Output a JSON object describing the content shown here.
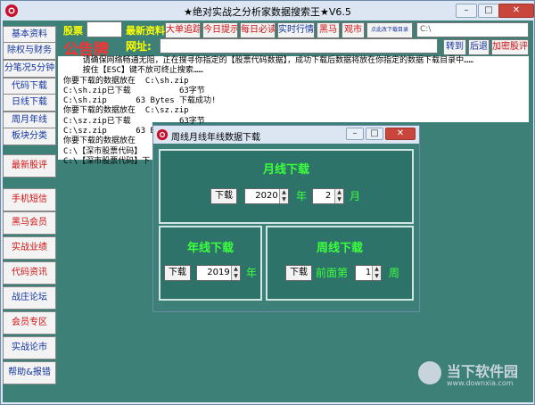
{
  "window": {
    "title": "★绝对实战之分析家数据搜索王★V6.5",
    "min": "–",
    "max": "□",
    "close": "✕"
  },
  "sidebar": [
    {
      "label": "基本资料",
      "color": "#1233a0"
    },
    {
      "label": "除权与财务",
      "color": "#1233a0"
    },
    {
      "label": "分笔况5分钟",
      "color": "#1233a0"
    },
    {
      "label": "代码下载",
      "color": "#1233a0"
    },
    {
      "label": "日线下载",
      "color": "#1233a0"
    },
    {
      "label": "周月年线",
      "color": "#1233a0"
    },
    {
      "label": "板块分类",
      "color": "#1233a0"
    },
    {
      "label": "最新股评",
      "color": "#d01010"
    },
    {
      "label": "手机短信",
      "color": "#d01010"
    },
    {
      "label": "黑马会员",
      "color": "#d01010"
    },
    {
      "label": "实战业绩",
      "color": "#d01010"
    },
    {
      "label": "代码资讯",
      "color": "#d01010"
    },
    {
      "label": "战庄论坛",
      "color": "#1233a0"
    },
    {
      "label": "会员专区",
      "color": "#d01010"
    },
    {
      "label": "实战论市",
      "color": "#1233a0"
    },
    {
      "label": "帮助&报错",
      "color": "#1233a0"
    }
  ],
  "toolbar": {
    "stock_label": "股票",
    "latest_label": "最新资料",
    "buttons": [
      "大单追踪",
      "今日提示",
      "每日必读",
      "实时行情",
      "黑马",
      "观市"
    ],
    "download_btn": "点此改下载目录",
    "path_value": "C:\\",
    "notice_label": "公告牌",
    "url_label": "网址:",
    "goto_btn": "转到",
    "back_btn": "后退",
    "fav_btn": "加密股评"
  },
  "log_lines": [
    "    请确保网络畅通无阻，正在搜寻你指定的【股票代码数据】，成功下载后数据将放在你指定的数据下载目录中……",
    "    按住【ESC】键不放可终止搜索……",
    "你要下载的数据放在  C:\\sh.zip",
    "C:\\sh.zip已下载          63字节",
    "C:\\sh.zip      63 Bytes 下载成功!",
    "你要下载的数据放在  C:\\sz.zip",
    "C:\\sz.zip已下载          63字节",
    "C:\\sz.zip      63 Bytes 下载成功!",
    "你要下载的数据放在",
    "C:\\【深市股票代码】",
    "C:\\【深市股票代码】下"
  ],
  "dialog": {
    "title": "周线月线年线数据下载",
    "month": {
      "title": "月线下载",
      "btn": "下载",
      "year": "2020",
      "year_unit": "年",
      "month": "2",
      "month_unit": "月"
    },
    "year": {
      "title": "年线下载",
      "btn": "下载",
      "year": "2019",
      "unit": "年"
    },
    "week": {
      "title": "周线下载",
      "btn": "下载",
      "prefix": "前面第",
      "value": "1",
      "unit": "周"
    }
  },
  "watermark": {
    "text": "当下软件园",
    "url": "www.downxia.com"
  }
}
